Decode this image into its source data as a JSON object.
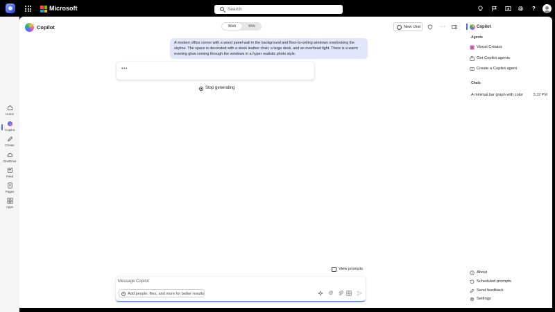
{
  "topbar": {
    "brand": "Microsoft",
    "search_placeholder": "Search",
    "icons": [
      "copilot-icon",
      "waffle-icon",
      "microsoft-logo-icon",
      "search-icon",
      "lightbulb-icon",
      "flag-icon",
      "download-icon",
      "gear-icon",
      "help-icon",
      "avatar"
    ]
  },
  "rail": {
    "items": [
      {
        "label": "Home",
        "icon": "home-icon"
      },
      {
        "label": "Copilot",
        "icon": "copilot-icon"
      },
      {
        "label": "Create",
        "icon": "pencil-icon"
      },
      {
        "label": "OneDrive",
        "icon": "cloud-icon"
      },
      {
        "label": "Feed",
        "icon": "feed-icon"
      },
      {
        "label": "Pages",
        "icon": "pages-icon"
      },
      {
        "label": "Apps",
        "icon": "apps-icon"
      }
    ],
    "active": "Copilot"
  },
  "header": {
    "title": "Copilot",
    "toggle": {
      "work": "Work",
      "web": "Web",
      "selected": "Work"
    },
    "new_chat": "New chat"
  },
  "conversation": {
    "user_message": "A modern office corner with a wood panel wall in the background and floor-to-ceiling windows overlooking the skyline. The space is decorated with a sleek leather chair, a large desk, and an overhead light. There is a warm evening glow coming through the windows in a hyper realistic photo style.",
    "response_typing": "•••",
    "stop_label": "Stop generating"
  },
  "composer": {
    "view_prompts": "View prompts",
    "placeholder": "Message Copilot",
    "add_label": "Add people, files, and more for better results"
  },
  "right_panel": {
    "title": "Copilot",
    "agents_header": "Agents",
    "agents": [
      {
        "label": "Visual Creator",
        "icon": "visual-creator-icon"
      },
      {
        "label": "Get Copilot agents",
        "icon": "store-icon"
      },
      {
        "label": "Create a Copilot agent",
        "icon": "add-agent-icon"
      }
    ],
    "chats_header": "Chats",
    "chats": [
      {
        "title": "A minimal bar graph with color",
        "time": "5:32 PM"
      }
    ],
    "footer": [
      {
        "label": "About",
        "icon": "info-icon"
      },
      {
        "label": "Scheduled prompts",
        "icon": "schedule-icon"
      },
      {
        "label": "Send feedback",
        "icon": "feedback-icon"
      },
      {
        "label": "Settings",
        "icon": "gear-icon"
      }
    ]
  },
  "colors": {
    "accent": "#4f6bed",
    "user_bubble": "#e0e6fb",
    "chrome": "#000000"
  }
}
